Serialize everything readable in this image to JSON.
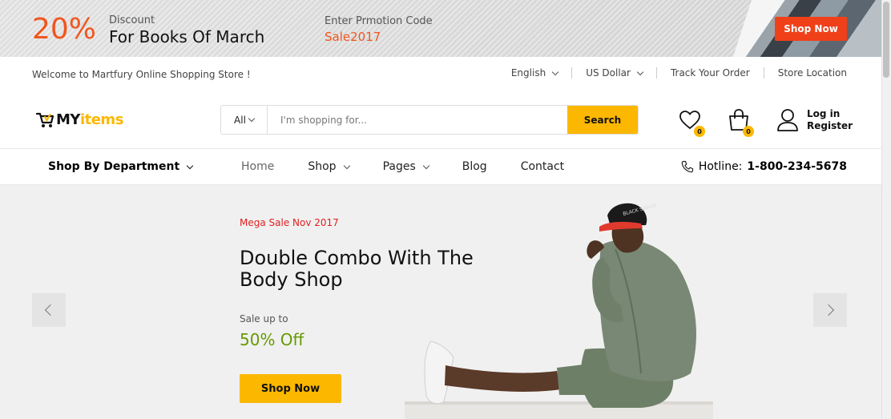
{
  "promo": {
    "percent": "20%",
    "discount_label": "Discount",
    "headline": "For Books Of March",
    "code_label": "Enter Prmotion Code",
    "code": "Sale2017",
    "button": "Shop Now"
  },
  "topbar": {
    "welcome": "Welcome to Martfury Online Shopping Store !",
    "language": "English",
    "currency": "US Dollar",
    "track": "Track Your Order",
    "location": "Store Location"
  },
  "header": {
    "logo_my": "MY",
    "logo_items": "items",
    "search_category": "All",
    "search_placeholder": "I'm shopping for...",
    "search_button": "Search",
    "wishlist_count": "0",
    "cart_count": "0",
    "login": "Log in",
    "register": "Register"
  },
  "nav": {
    "department": "Shop By Department",
    "menu": [
      "Home",
      "Shop",
      "Pages",
      "Blog",
      "Contact"
    ],
    "hotline_label": "Hotline:",
    "hotline_number": "1-800-234-5678"
  },
  "hero": {
    "tag": "Mega Sale Nov 2017",
    "title": "Double Combo With The Body Shop",
    "sale_label": "Sale up to",
    "sale_value": "50% Off",
    "button": "Shop Now",
    "cap_text": "BLACK SWADE"
  },
  "colors": {
    "accent_orange": "#f0561e",
    "accent_yellow": "#fcb800",
    "sale_green": "#669900",
    "tag_red": "#e02020"
  }
}
